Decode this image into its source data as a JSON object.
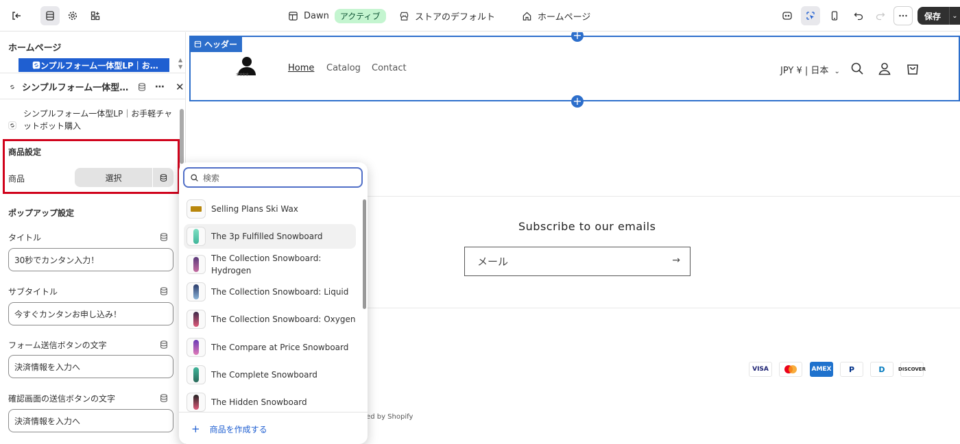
{
  "topbar": {
    "theme_name": "Dawn",
    "theme_badge": "アクティブ",
    "store_default": "ストアのデフォルト",
    "page_select": "ホームページ",
    "save_label": "保存"
  },
  "sidebar": {
    "page_title": "ホームページ",
    "selected_block": "シンプルフォーム一体型LP｜お…",
    "block_title": "シンプルフォーム一体型L...",
    "block_desc": "シンプルフォーム一体型LP｜お手軽チャットボット購入",
    "product_section_title": "商品設定",
    "product_label": "商品",
    "select_button": "選択",
    "popup_section_title": "ポップアップ設定",
    "fields": [
      {
        "label": "タイトル",
        "value": "30秒でカンタン入力！"
      },
      {
        "label": "サブタイトル",
        "value": "今すぐカンタンお申し込み！"
      },
      {
        "label": "フォーム送信ボタンの文字",
        "value": "決済情報を入力へ"
      },
      {
        "label": "確認画面の送信ボタンの文字",
        "value": "決済情報を入力へ"
      }
    ]
  },
  "preview": {
    "header_tag": "ヘッダー",
    "logo_text": "****",
    "nav": [
      "Home",
      "Catalog",
      "Contact"
    ],
    "currency": "JPY ¥ | 日本",
    "subscribe_title": "Subscribe to our emails",
    "email_placeholder": "メール",
    "payments": [
      "VISA",
      "MC",
      "AMEX",
      "P",
      "D",
      "DISCOVER"
    ],
    "powered": "ered by Shopify"
  },
  "product_picker": {
    "search_placeholder": "検索",
    "items": [
      "Selling Plans Ski Wax",
      "The 3p Fulfilled Snowboard",
      "The Collection Snowboard: Hydrogen",
      "The Collection Snowboard: Liquid",
      "The Collection Snowboard: Oxygen",
      "The Compare at Price Snowboard",
      "The Complete Snowboard",
      "The Hidden Snowboard"
    ],
    "create_label": "商品を作成する"
  },
  "colors": {
    "accent": "#2c6ecb",
    "highlight": "#d0021b",
    "badge_bg": "#c4f5d0"
  }
}
